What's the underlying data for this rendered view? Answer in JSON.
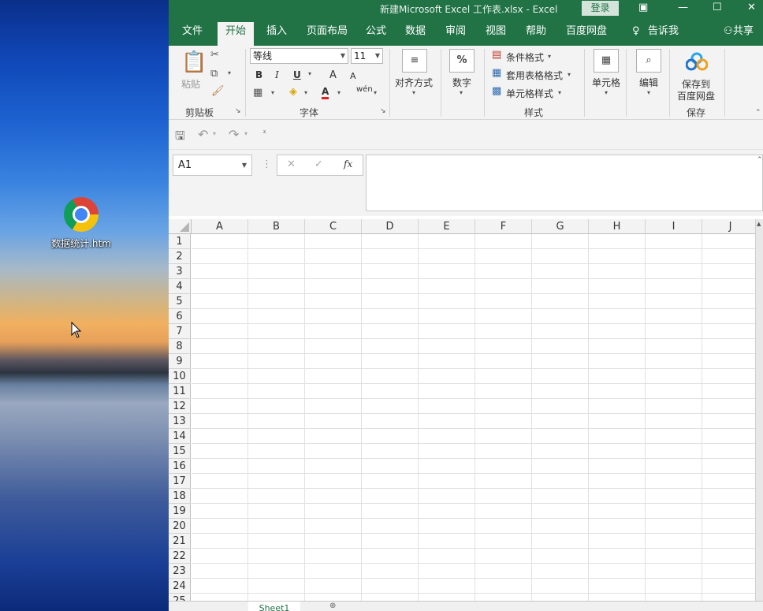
{
  "desktop": {
    "icon_label": "数据统计.htm"
  },
  "window": {
    "title": "新建Microsoft Excel 工作表.xlsx  -  Excel",
    "login_label": "登录"
  },
  "tabs": [
    {
      "label": "文件"
    },
    {
      "label": "开始"
    },
    {
      "label": "插入"
    },
    {
      "label": "页面布局"
    },
    {
      "label": "公式"
    },
    {
      "label": "数据"
    },
    {
      "label": "审阅"
    },
    {
      "label": "视图"
    },
    {
      "label": "帮助"
    },
    {
      "label": "百度网盘"
    },
    {
      "label": "告诉我"
    },
    {
      "label": "共享"
    }
  ],
  "ribbon": {
    "clipboard": {
      "paste": "粘贴",
      "group": "剪贴板"
    },
    "font": {
      "name": "等线",
      "size": "11",
      "bold": "B",
      "italic": "I",
      "underline": "U",
      "grow": "A",
      "shrink": "A",
      "color": "A",
      "pinyin": "wén",
      "group": "字体"
    },
    "alignment": {
      "label": "对齐方式"
    },
    "number": {
      "label": "数字",
      "symbol": "%"
    },
    "styles": {
      "conditional": "条件格式",
      "table": "套用表格格式",
      "cell": "单元格样式",
      "group": "样式"
    },
    "cells": {
      "label": "单元格"
    },
    "editing": {
      "label": "编辑"
    },
    "save": {
      "line1": "保存到",
      "line2": "百度网盘",
      "group": "保存"
    }
  },
  "formula_bar": {
    "name_box": "A1",
    "fx": "fx",
    "value": ""
  },
  "sheet": {
    "columns": [
      "A",
      "B",
      "C",
      "D",
      "E",
      "F",
      "G",
      "H",
      "I",
      "J"
    ],
    "rows": [
      "1",
      "2",
      "3",
      "4",
      "5",
      "6",
      "7",
      "8",
      "9",
      "10",
      "11",
      "12",
      "13",
      "14",
      "15",
      "16",
      "17",
      "18",
      "19",
      "20",
      "21",
      "22",
      "23",
      "24",
      "25"
    ]
  },
  "sheet_tabs": [
    {
      "label": "Sheet1"
    }
  ]
}
